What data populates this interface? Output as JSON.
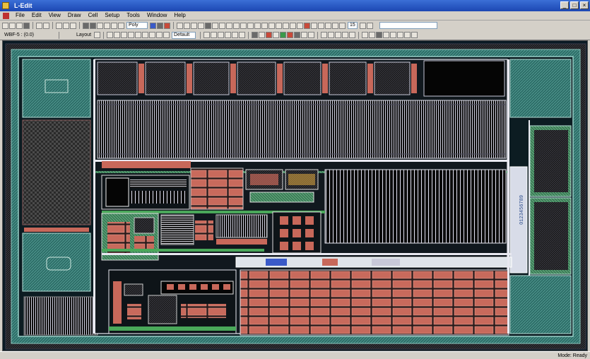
{
  "window": {
    "title": "L-Edit",
    "minimize_label": "_",
    "maximize_label": "□",
    "close_label": "×"
  },
  "menu": {
    "items": [
      {
        "label": "File"
      },
      {
        "label": "Edit"
      },
      {
        "label": "View"
      },
      {
        "label": "Draw"
      },
      {
        "label": "Cell"
      },
      {
        "label": "Setup"
      },
      {
        "label": "Tools"
      },
      {
        "label": "Window"
      },
      {
        "label": "Help"
      }
    ]
  },
  "toolbar": {
    "layer_combo": "Poly",
    "zoom_value": "15",
    "coord_readout": "WBF-5 : (0.0)",
    "layer_select": "Layout",
    "mode_combo": "Default"
  },
  "status": {
    "left": "",
    "right": "Mode: Ready"
  },
  "colors": {
    "background": "#0a1a24",
    "teal_fill": "#2f6f6a",
    "metal_red": "#c8685a",
    "hatch_dark": "#1c1c1c",
    "wire_white": "#e8e8f0",
    "accent_green": "#4aa85a"
  }
}
